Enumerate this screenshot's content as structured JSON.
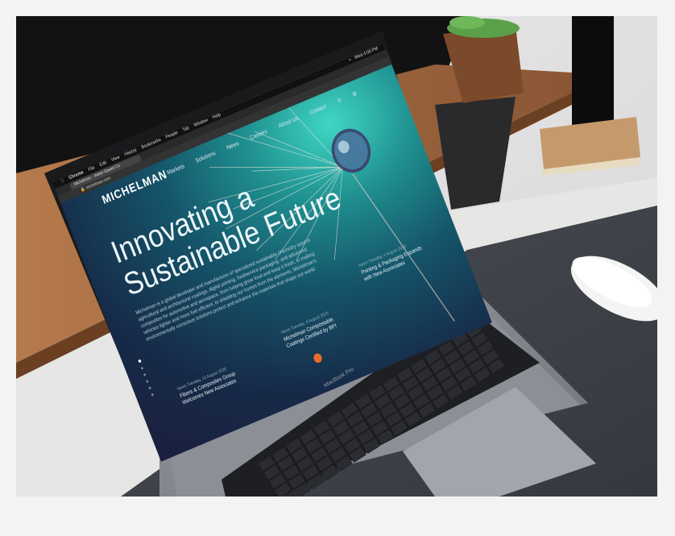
{
  "menubar": {
    "app": "Chrome",
    "items": [
      "File",
      "Edit",
      "View",
      "History",
      "Bookmarks",
      "People",
      "Tab",
      "Window",
      "Help"
    ],
    "status": "Wed 4:08 PM"
  },
  "browser": {
    "tab_title": "Michelman - Water-Based Co",
    "url": "michelman.com"
  },
  "site": {
    "logo": "MICHELMAN",
    "nav": [
      "Markets",
      "Solutions",
      "News",
      "Careers",
      "About Us",
      "Contact"
    ],
    "hero_title": "Innovating a Sustainable Future",
    "hero_body": "Michelman is a global developer and manufacturer of specialized sustainable chemistry used in agricultural and architectural coatings, digital printing, foodservice packaging, and advanced composites for automotive and aerospace, from helping grow food and keep it fresh, to making vehicles lighter and more fuel efficient, to shielding our homes from the elements. Michelman's environmentally conscious solutions protect and enhance the materials that shape our world.",
    "news": [
      {
        "date": "News Tuesday, 13 August 2020",
        "title": "Fibers & Composites Group Welcomes New Associates"
      },
      {
        "date": "News Tuesday, 4 August 2020",
        "title": "Michelman Compostable Coatings Certified by BPI"
      },
      {
        "date": "News Tuesday, 4 August 2020",
        "title": "Printing & Packaging Expands with New Associates"
      }
    ]
  },
  "laptop": {
    "brand": "MacBook Pro"
  },
  "colors": {
    "frame": "#f3f3f3",
    "accent_orange": "#e86a2e",
    "screen_teal": "#1f8f8f",
    "screen_navy": "#1b1f3e"
  }
}
